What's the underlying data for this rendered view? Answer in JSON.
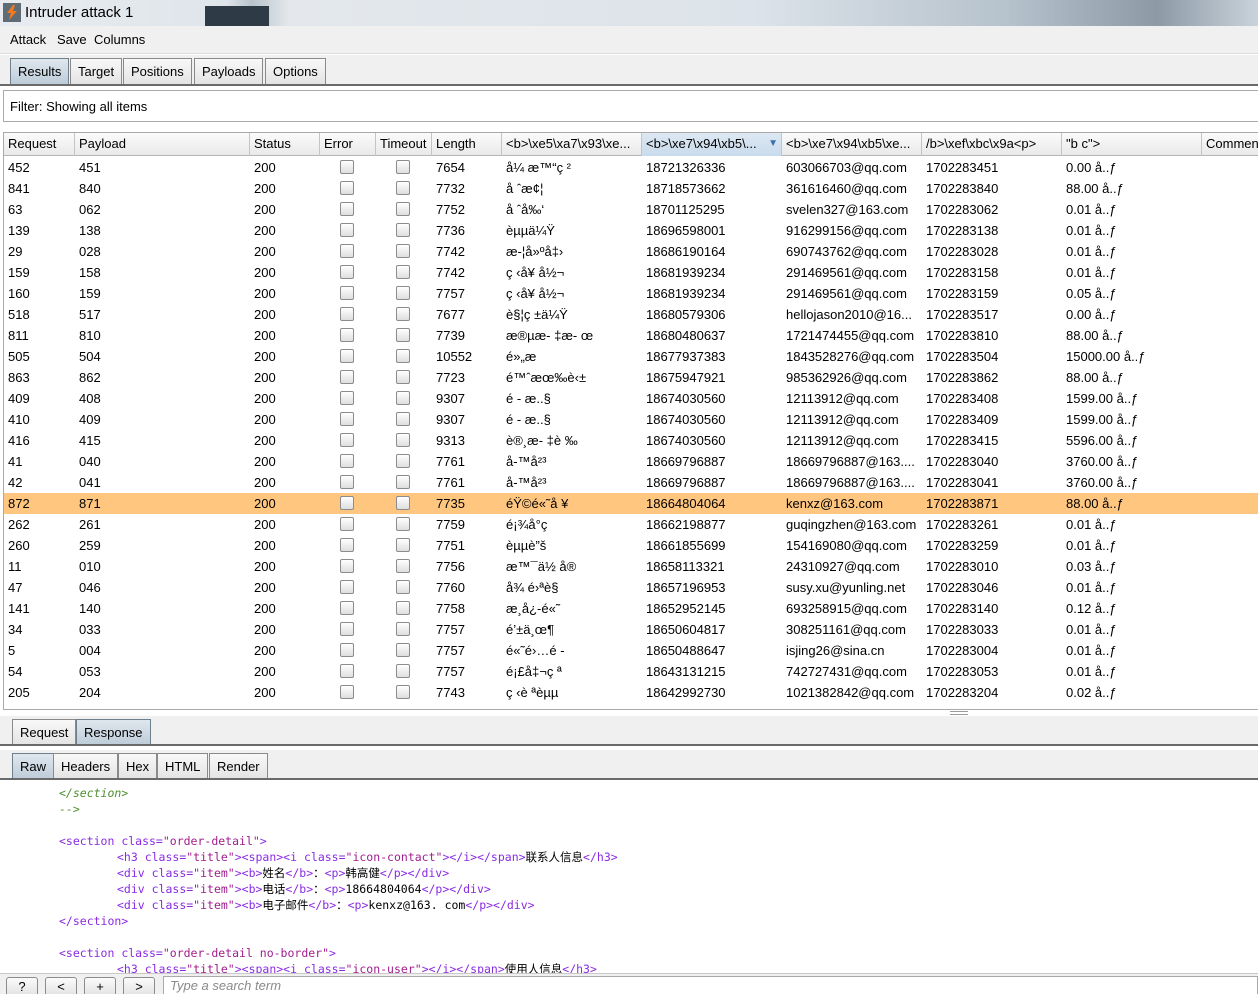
{
  "window": {
    "title": "Intruder attack 1"
  },
  "menu": [
    "Attack",
    "Save",
    "Columns"
  ],
  "top_tabs": [
    {
      "label": "Results",
      "active": true
    },
    {
      "label": "Target",
      "active": false
    },
    {
      "label": "Positions",
      "active": false
    },
    {
      "label": "Payloads",
      "active": false
    },
    {
      "label": "Options",
      "active": false
    }
  ],
  "filter_text": "Filter: Showing all items",
  "columns": [
    {
      "key": "request",
      "label": "Request"
    },
    {
      "key": "payload",
      "label": "Payload"
    },
    {
      "key": "status",
      "label": "Status"
    },
    {
      "key": "error",
      "label": "Error"
    },
    {
      "key": "timeout",
      "label": "Timeout"
    },
    {
      "key": "length",
      "label": "Length"
    },
    {
      "key": "c1",
      "label": "<b>\\xe5\\xa7\\x93\\xe..."
    },
    {
      "key": "c2",
      "label": "<b>\\xe7\\x94\\xb5\\...",
      "sorted": "desc"
    },
    {
      "key": "c3",
      "label": "<b>\\xe7\\x94\\xb5\\xe..."
    },
    {
      "key": "c4",
      "label": "/b>\\xef\\xbc\\x9a<p>"
    },
    {
      "key": "c5",
      "label": "\"b c\">"
    },
    {
      "key": "comment",
      "label": "Commen"
    }
  ],
  "rows": [
    {
      "request": "452",
      "payload": "451",
      "status": "200",
      "length": "7654",
      "c1": "å¼ æ™“ç ²",
      "c2": "18721326336",
      "c3": "603066703@qq.com",
      "c4": "1702283451",
      "c5": "0.00 å..ƒ"
    },
    {
      "request": "841",
      "payload": "840",
      "status": "200",
      "length": "7732",
      "c1": "å ˆæ¢¦",
      "c2": "18718573662",
      "c3": "361616460@qq.com",
      "c4": "1702283840",
      "c5": "88.00 å..ƒ"
    },
    {
      "request": "63",
      "payload": "062",
      "status": "200",
      "length": "7752",
      "c1": "å ˆå‰‘",
      "c2": "18701125295",
      "c3": "svelen327@163.com",
      "c4": "1702283062",
      "c5": "0.01 å..ƒ"
    },
    {
      "request": "139",
      "payload": "138",
      "status": "200",
      "length": "7736",
      "c1": "èµµä¼Ÿ",
      "c2": "18696598001",
      "c3": "916299156@qq.com",
      "c4": "1702283138",
      "c5": "0.01 å..ƒ"
    },
    {
      "request": "29",
      "payload": "028",
      "status": "200",
      "length": "7742",
      "c1": "æ-¦å»ºå‡›",
      "c2": "18686190164",
      "c3": "690743762@qq.com",
      "c4": "1702283028",
      "c5": "0.01 å..ƒ"
    },
    {
      "request": "159",
      "payload": "158",
      "status": "200",
      "length": "7742",
      "c1": "ç ‹å¥ å½¬",
      "c2": "18681939234",
      "c3": "291469561@qq.com",
      "c4": "1702283158",
      "c5": "0.01 å..ƒ"
    },
    {
      "request": "160",
      "payload": "159",
      "status": "200",
      "length": "7757",
      "c1": "ç ‹å¥ å½¬",
      "c2": "18681939234",
      "c3": "291469561@qq.com",
      "c4": "1702283159",
      "c5": "0.05 å..ƒ"
    },
    {
      "request": "518",
      "payload": "517",
      "status": "200",
      "length": "7677",
      "c1": "è§¦ç ±ä¼Ÿ",
      "c2": "18680579306",
      "c3": "hellojason2010@16...",
      "c4": "1702283517",
      "c5": "0.00 å..ƒ"
    },
    {
      "request": "811",
      "payload": "810",
      "status": "200",
      "length": "7739",
      "c1": "æ®µæ- ‡æ- œ",
      "c2": "18680480637",
      "c3": "1721474455@qq.com",
      "c4": "1702283810",
      "c5": "88.00 å..ƒ"
    },
    {
      "request": "505",
      "payload": "504",
      "status": "200",
      "length": "10552",
      "c1": "é»„æ",
      "c2": "18677937383",
      "c3": "1843528276@qq.com",
      "c4": "1702283504",
      "c5": "15000.00 å..ƒ"
    },
    {
      "request": "863",
      "payload": "862",
      "status": "200",
      "length": "7723",
      "c1": "é™ˆæœ‰è‹±",
      "c2": "18675947921",
      "c3": "985362926@qq.com",
      "c4": "1702283862",
      "c5": "88.00 å..ƒ"
    },
    {
      "request": "409",
      "payload": "408",
      "status": "200",
      "length": "9307",
      "c1": "é - æ..§",
      "c2": "18674030560",
      "c3": "12113912@qq.com",
      "c4": "1702283408",
      "c5": "1599.00 å..ƒ"
    },
    {
      "request": "410",
      "payload": "409",
      "status": "200",
      "length": "9307",
      "c1": "é - æ..§",
      "c2": "18674030560",
      "c3": "12113912@qq.com",
      "c4": "1702283409",
      "c5": "1599.00 å..ƒ"
    },
    {
      "request": "416",
      "payload": "415",
      "status": "200",
      "length": "9313",
      "c1": "è®¸æ- ‡è ‰",
      "c2": "18674030560",
      "c3": "12113912@qq.com",
      "c4": "1702283415",
      "c5": "5596.00 å..ƒ"
    },
    {
      "request": "41",
      "payload": "040",
      "status": "200",
      "length": "7761",
      "c1": "å-™å²³",
      "c2": "18669796887",
      "c3": "18669796887@163....",
      "c4": "1702283040",
      "c5": "3760.00 å..ƒ"
    },
    {
      "request": "42",
      "payload": "041",
      "status": "200",
      "length": "7761",
      "c1": "å-™å²³",
      "c2": "18669796887",
      "c3": "18669796887@163....",
      "c4": "1702283041",
      "c5": "3760.00 å..ƒ"
    },
    {
      "request": "872",
      "payload": "871",
      "status": "200",
      "length": "7735",
      "c1": "éŸ©é«˜å ¥",
      "c2": "18664804064",
      "c3": "kenxz@163.com",
      "c4": "1702283871",
      "c5": "88.00 å..ƒ",
      "selected": true
    },
    {
      "request": "262",
      "payload": "261",
      "status": "200",
      "length": "7759",
      "c1": "é¡¾å°ç",
      "c2": "18662198877",
      "c3": "guqingzhen@163.com",
      "c4": "1702283261",
      "c5": "0.01 å..ƒ"
    },
    {
      "request": "260",
      "payload": "259",
      "status": "200",
      "length": "7751",
      "c1": "èµµè”š",
      "c2": "18661855699",
      "c3": "154169080@qq.com",
      "c4": "1702283259",
      "c5": "0.01 å..ƒ"
    },
    {
      "request": "11",
      "payload": "010",
      "status": "200",
      "length": "7756",
      "c1": "æ™¯ä½ å®",
      "c2": "18658113321",
      "c3": "24310927@qq.com",
      "c4": "1702283010",
      "c5": "0.03 å..ƒ"
    },
    {
      "request": "47",
      "payload": "046",
      "status": "200",
      "length": "7760",
      "c1": "å¾ é›ªè§",
      "c2": "18657196953",
      "c3": "susy.xu@yunling.net",
      "c4": "1702283046",
      "c5": "0.01 å..ƒ"
    },
    {
      "request": "141",
      "payload": "140",
      "status": "200",
      "length": "7758",
      "c1": "æ¸å¿-é«˜",
      "c2": "18652952145",
      "c3": "693258915@qq.com",
      "c4": "1702283140",
      "c5": "0.12 å..ƒ"
    },
    {
      "request": "34",
      "payload": "033",
      "status": "200",
      "length": "7757",
      "c1": "é’±ä¸œ¶",
      "c2": "18650604817",
      "c3": "308251161@qq.com",
      "c4": "1702283033",
      "c5": "0.01 å..ƒ"
    },
    {
      "request": "5",
      "payload": "004",
      "status": "200",
      "length": "7757",
      "c1": "é«˜é›…é -",
      "c2": "18650488647",
      "c3": "isjing26@sina.cn",
      "c4": "1702283004",
      "c5": "0.01 å..ƒ"
    },
    {
      "request": "54",
      "payload": "053",
      "status": "200",
      "length": "7757",
      "c1": "é¡£å‡¬ç ª",
      "c2": "18643131215",
      "c3": "742727431@qq.com",
      "c4": "1702283053",
      "c5": "0.01 å..ƒ"
    },
    {
      "request": "205",
      "payload": "204",
      "status": "200",
      "length": "7743",
      "c1": "ç ‹è ªèµµ",
      "c2": "18642992730",
      "c3": "1021382842@qq.com",
      "c4": "1702283204",
      "c5": "0.02 å..ƒ"
    }
  ],
  "message_tabs": [
    {
      "label": "Request",
      "active": false
    },
    {
      "label": "Response",
      "active": true
    }
  ],
  "view_tabs": [
    {
      "label": "Raw",
      "active": true
    },
    {
      "label": "Headers",
      "active": false
    },
    {
      "label": "Hex",
      "active": false
    },
    {
      "label": "HTML",
      "active": false
    },
    {
      "label": "Render",
      "active": false
    }
  ],
  "code": {
    "l1": "</section>",
    "l2": "-->",
    "l4_open": "<section ",
    "l4_attr": "class=",
    "l4_val": "\"order-detail\"",
    "l4_close": ">",
    "l5_a": "<h3 ",
    "l5_b": "class=",
    "l5_c": "\"title\"",
    "l5_d": "><span><i ",
    "l5_e": "class=",
    "l5_f": "\"icon-contact\"",
    "l5_g": "></i></span>",
    "l5_text": "联系人信息",
    "l5_end": "</h3>",
    "l6_a": "<div ",
    "l6_b": "class=",
    "l6_c": "\"item\"",
    "l6_d": "><b>",
    "l6_text1": "姓名",
    "l6_e": "</b>",
    "l6_text2": "：",
    "l6_f": "<p>",
    "l6_text3": "韩高健",
    "l6_g": "</p></div>",
    "l7_text1": "电话",
    "l7_text3": "18664804064",
    "l8_text1": "电子邮件",
    "l8_text3": "kenxz@163. com",
    "l9": "</section>",
    "l11_a": "<section ",
    "l11_b": "class=",
    "l11_c": "\"order-detail no-border\"",
    "l11_d": ">",
    "l12_a": "<h3 ",
    "l12_b": "class=",
    "l12_c": "\"title\"",
    "l12_d": "><span><i ",
    "l12_e": "class=",
    "l12_f": "\"icon-user\"",
    "l12_g": "></i></span>",
    "l12_text": "使用人信息",
    "l12_end": "</h3>"
  },
  "search": {
    "help": "?",
    "prev": "<",
    "plus": "+",
    "next": ">",
    "placeholder": "Type a search term"
  }
}
